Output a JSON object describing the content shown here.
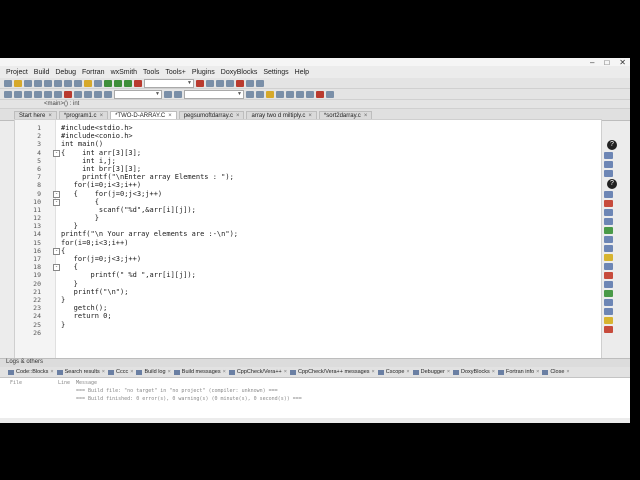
{
  "menu": [
    "Project",
    "Build",
    "Debug",
    "Fortran",
    "wxSmith",
    "Tools",
    "Tools+",
    "Plugins",
    "DoxyBlocks",
    "Settings",
    "Help"
  ],
  "toolbar": {
    "label": "<main>() : int"
  },
  "tabs": [
    {
      "label": "Start here"
    },
    {
      "label": "*program1.c"
    },
    {
      "label": "*TWO-D-ARRAY.C"
    },
    {
      "label": "pegsumoftdarray.c"
    },
    {
      "label": "array two d miltiply.c"
    },
    {
      "label": "*sort2darray.c"
    }
  ],
  "code_lines": [
    {
      "n": "1",
      "text": "#include<stdio.h>",
      "fold": ""
    },
    {
      "n": "2",
      "text": "#include<conio.h>",
      "fold": ""
    },
    {
      "n": "3",
      "text": "int main()",
      "fold": ""
    },
    {
      "n": "4",
      "text": "{    int arr[3][3];",
      "fold": "-"
    },
    {
      "n": "5",
      "text": "     int i,j;",
      "fold": ""
    },
    {
      "n": "6",
      "text": "     int brr[3][3];",
      "fold": ""
    },
    {
      "n": "7",
      "text": "     printf(\"\\nEnter array Elements : \");",
      "fold": ""
    },
    {
      "n": "8",
      "text": "   for(i=0;i<3;i++)",
      "fold": ""
    },
    {
      "n": "9",
      "text": "   {    for(j=0;j<3;j++)",
      "fold": "-"
    },
    {
      "n": "10",
      "text": "        {",
      "fold": "-"
    },
    {
      "n": "11",
      "text": "         scanf(\"%d\",&arr[i][j]);",
      "fold": ""
    },
    {
      "n": "12",
      "text": "        }",
      "fold": ""
    },
    {
      "n": "13",
      "text": "   }",
      "fold": ""
    },
    {
      "n": "14",
      "text": "printf(\"\\n Your array elements are :-\\n\");",
      "fold": ""
    },
    {
      "n": "15",
      "text": "for(i=0;i<3;i++)",
      "fold": ""
    },
    {
      "n": "16",
      "text": "{",
      "fold": "-"
    },
    {
      "n": "17",
      "text": "   for(j=0;j<3;j++)",
      "fold": ""
    },
    {
      "n": "18",
      "text": "   {",
      "fold": "-"
    },
    {
      "n": "19",
      "text": "       printf(\" %d \",arr[i][j]);",
      "fold": ""
    },
    {
      "n": "20",
      "text": "   }",
      "fold": ""
    },
    {
      "n": "21",
      "text": "   printf(\"\\n\");",
      "fold": ""
    },
    {
      "n": "22",
      "text": "}",
      "fold": ""
    },
    {
      "n": "23",
      "text": "   getch();",
      "fold": ""
    },
    {
      "n": "24",
      "text": "   return 0;",
      "fold": ""
    },
    {
      "n": "25",
      "text": "}",
      "fold": ""
    },
    {
      "n": "26",
      "text": "",
      "fold": ""
    }
  ],
  "logs": {
    "header": "Logs & others",
    "tabs": [
      "Code::Blocks",
      "Search results",
      "Cccc",
      "Build log",
      "Build messages",
      "CppCheck/Vera++",
      "CppCheck/Vera++ messages",
      "Cscope",
      "Debugger",
      "DoxyBlocks",
      "Fortran info",
      "Close"
    ],
    "columns": [
      "File",
      "Line",
      "Message"
    ],
    "messages": [
      "=== Build file: \"no target\" in \"no project\" (compiler: unknown) ===",
      "=== Build finished: 0 error(s), 0 warning(s) (0 minute(s), 0 second(s)) ==="
    ]
  },
  "colors": {
    "keyword": "#1a1a1a",
    "background": "#ffffff",
    "chrome": "#ececec"
  }
}
